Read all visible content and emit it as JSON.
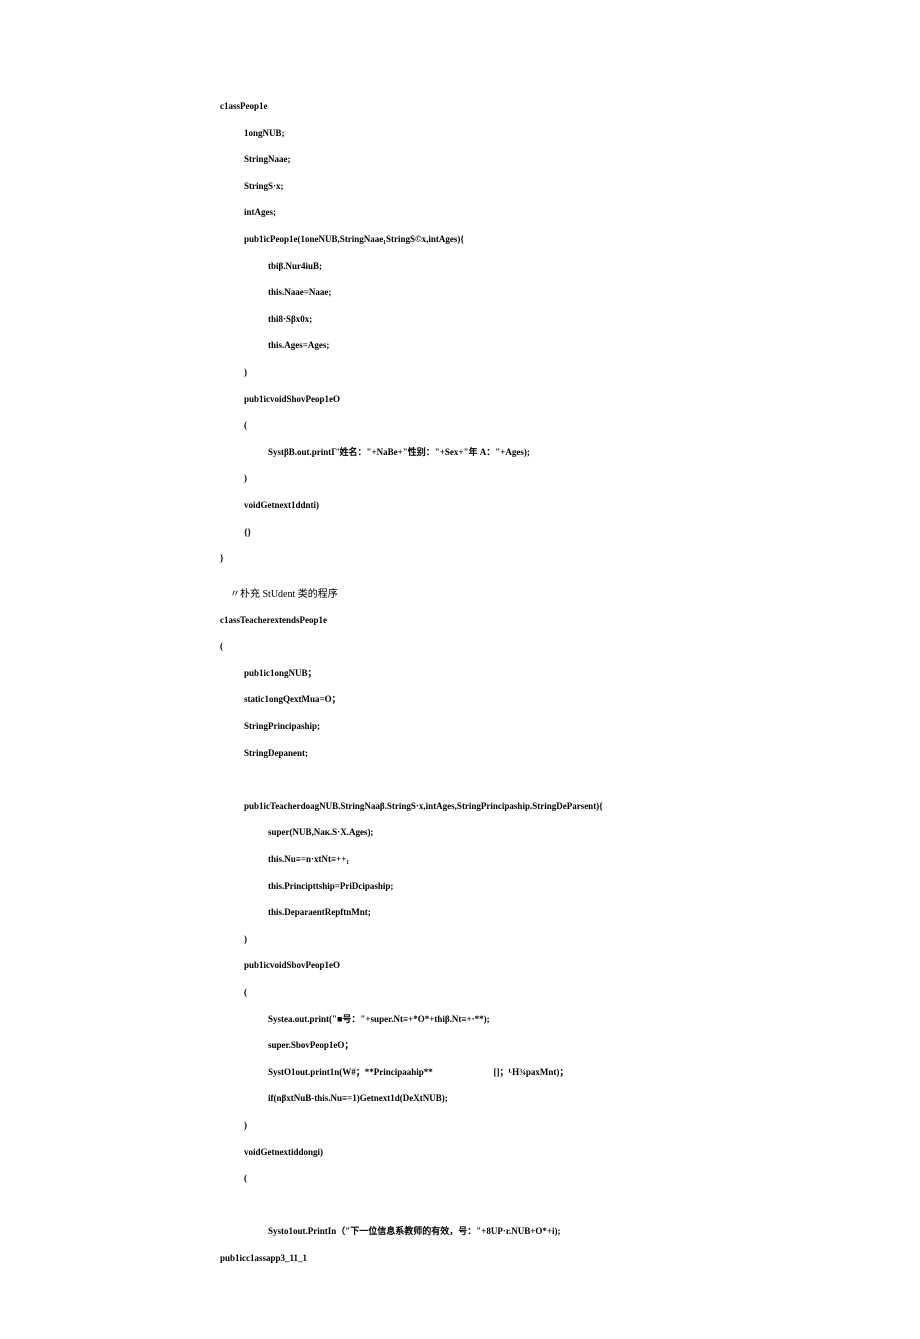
{
  "lines": [
    {
      "indent": 0,
      "text": "c1assPeop1e"
    },
    {
      "indent": 1,
      "text": "1ongNUB;"
    },
    {
      "indent": 1,
      "text": "StringNaae;"
    },
    {
      "indent": 1,
      "text": "StringS·x;"
    },
    {
      "indent": 1,
      "text": "intAges;"
    },
    {
      "indent": 1,
      "text": "pub1icPeop1e(1oneNUB,StringNaae₁StringS©x,intAges){"
    },
    {
      "indent": 2,
      "text": "tbiβ.Nur4iuB;"
    },
    {
      "indent": 2,
      "text": "this.Naae=Naae;"
    },
    {
      "indent": 2,
      "text": "thi8·Sβx0x;"
    },
    {
      "indent": 2,
      "text": "this.Ages=Ages;"
    },
    {
      "indent": 1,
      "text": ")"
    },
    {
      "indent": 1,
      "text": "pub1icvoidShovPeop1eO"
    },
    {
      "indent": 1,
      "text": "("
    },
    {
      "indent": 2,
      "text": "SystβB.out.printΓ'姓名：\"+NaBe+\"性别：\"+Sex+\"年 A：\"+Ages);"
    },
    {
      "indent": 1,
      "text": ")"
    },
    {
      "indent": 1,
      "text": "voidGetnext1ddnti)"
    },
    {
      "indent": 1,
      "text": "{}"
    },
    {
      "indent": 0,
      "text": "}"
    }
  ],
  "comment": "〃朴充 StUdent 类的程序",
  "lines2": [
    {
      "indent": 0,
      "text": "c1assTeacherextendsPeop1e"
    },
    {
      "indent": 0,
      "text": "("
    },
    {
      "indent": 1,
      "text": "pub1ic1ongNUB；"
    },
    {
      "indent": 1,
      "text": "static1ongQextMua=O；"
    },
    {
      "indent": 1,
      "text": "StringPrincipaship;"
    },
    {
      "indent": 1,
      "text": "StringDepanent;"
    },
    {
      "indent": 1,
      "text": ""
    },
    {
      "indent": 1,
      "text": "pub1icTeacherdoagNUB.StringNaaβ.StringS·x,intAges,StringPrincipaship.StringDeParsent){"
    },
    {
      "indent": 2,
      "text": "super(NUB,Naк.S·X.Ages);"
    },
    {
      "indent": 2,
      "text": "this.Nu≡=n·xtNt≡++₁"
    },
    {
      "indent": 2,
      "text": "this.Principttship=PriDcipaship;"
    },
    {
      "indent": 2,
      "text": "this.DeparaentRepftnMnt;"
    },
    {
      "indent": 1,
      "text": ")"
    },
    {
      "indent": 1,
      "text": "pub1icvoidSbovPeop1eO"
    },
    {
      "indent": 1,
      "text": "("
    },
    {
      "indent": 2,
      "text": "Systea.out.print(\"■号：\"+super.Nt≡+*O*+thiβ.Nt≡+·**);"
    },
    {
      "indent": 2,
      "text": "super.SbovPeop1eO；"
    },
    {
      "indent": 2,
      "text": "SystO1out.print1n(W#；**Principaahip**                           []；ᴸH¾paxMnt)；"
    },
    {
      "indent": 2,
      "text": "if(nβxtNuB-this.Nu≡=1)Getnext1d(DeXtNUB);"
    },
    {
      "indent": 1,
      "text": ")"
    },
    {
      "indent": 1,
      "text": "voidGetnextiddongi)"
    },
    {
      "indent": 1,
      "text": "("
    },
    {
      "indent": 1,
      "text": ""
    },
    {
      "indent": 2,
      "text": "Systo1out.PrintIn（\"下一位信息系教师的有效，号：\"+8UP·r.NUB+O*+i);"
    },
    {
      "indent": 0,
      "text": "pub1icc1assapp3_11_1"
    }
  ]
}
